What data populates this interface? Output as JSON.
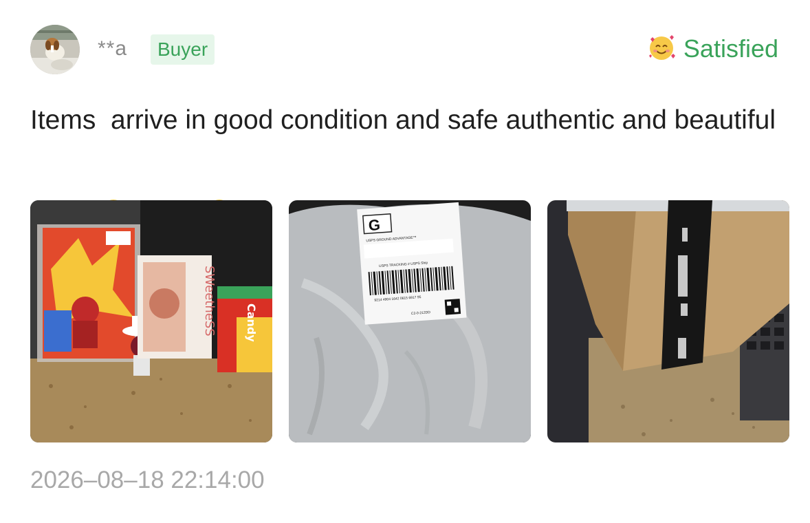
{
  "review": {
    "username": "**a",
    "badge": "Buyer",
    "satisfaction": {
      "label": "Satisfied",
      "icon": "smiling-face-with-hearts-icon"
    },
    "text": "Items  arrive in good condition and safe authentic and beautiful",
    "emojis": [
      "heart-eyes-icon",
      "star-struck-icon",
      "ok-hand-icon",
      "heart-exclamation-icon"
    ],
    "photos": [
      {
        "name": "photo-figures",
        "box_label": "SWeetheSS",
        "box2_label": "Candy"
      },
      {
        "name": "photo-package",
        "label_letter": "G",
        "service": "USPS GROUND ADVANTAGE™",
        "tracking_header": "USPS TRACKING # USPS Ship",
        "tracking_number": "9214 4904 1642 0615 6917 95",
        "route": "C2-0-212DD"
      },
      {
        "name": "photo-box"
      }
    ],
    "timestamp": "2026–08–18 22:14:00"
  },
  "colors": {
    "accent_green": "#3aa35a",
    "badge_bg": "#e6f6ea",
    "muted_text": "#8a8a8a",
    "timestamp_text": "#a8a8a8"
  }
}
